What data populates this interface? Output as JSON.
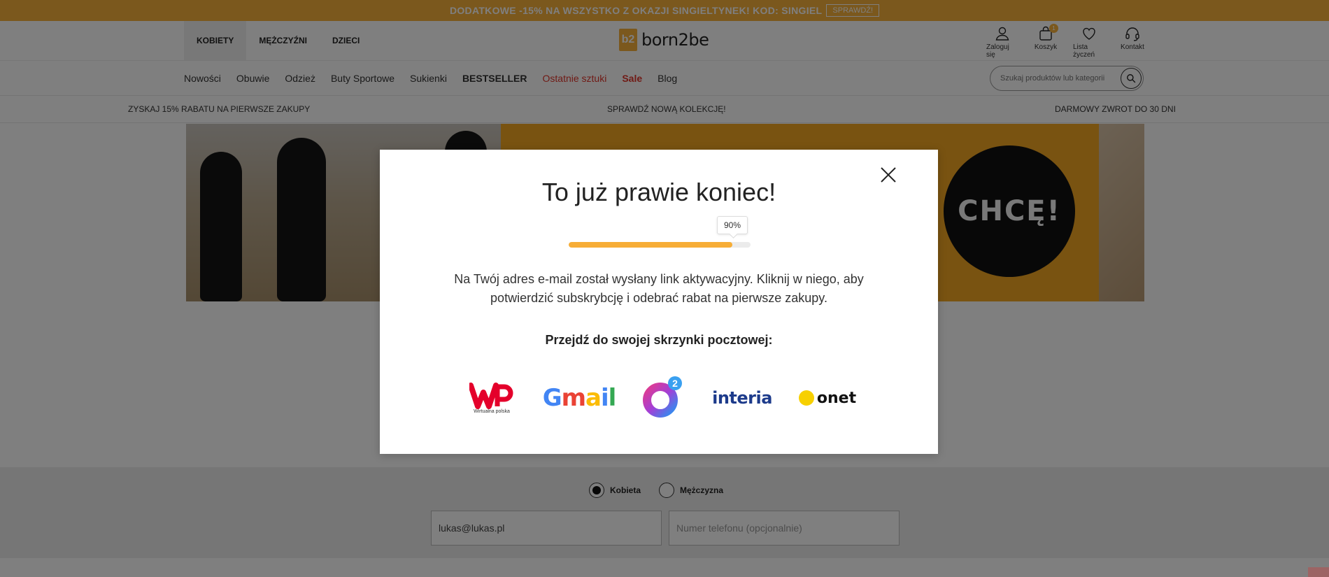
{
  "promo": {
    "text": "DODATKOWE -15% NA WSZYSTKO Z OKAZJI SINGIELTYNEK! KOD: SINGIEL",
    "button": "SPRAWDŹ!"
  },
  "header": {
    "gender_tabs": [
      "KOBIETY",
      "MĘŻCZYŹNI",
      "DZIECI"
    ],
    "logo_mark": "b2",
    "logo_text": "born2be",
    "icons": [
      {
        "label": "Zaloguj się",
        "icon": "user-icon"
      },
      {
        "label": "Koszyk",
        "icon": "bag-icon",
        "badge": "1"
      },
      {
        "label": "Lista życzeń",
        "icon": "heart-icon"
      },
      {
        "label": "Kontakt",
        "icon": "headset-icon"
      }
    ]
  },
  "nav": {
    "items": [
      "Nowości",
      "Obuwie",
      "Odzież",
      "Buty Sportowe",
      "Sukienki",
      "BESTSELLER",
      "Ostatnie sztuki",
      "Sale",
      "Blog"
    ],
    "search_placeholder": "Szukaj produktów lub kategorii"
  },
  "usp": [
    "ZYSKAJ 15% RABATU NA PIERWSZE ZAKUPY",
    "SPRAWDŹ NOWĄ KOLEKCJĘ!",
    "DARMOWY ZWROT DO 30 DNI"
  ],
  "banner": {
    "cta": "CHCĘ!"
  },
  "signup_form": {
    "genders": [
      "Kobieta",
      "Mężczyzna"
    ],
    "selected_gender": "Kobieta",
    "email_value": "lukas@lukas.pl",
    "phone_placeholder": "Numer telefonu (opcjonalnie)"
  },
  "modal": {
    "title": "To już prawie koniec!",
    "progress_label": "90%",
    "progress_value": 0.9,
    "body": "Na Twój adres e-mail został wysłany link aktywacyjny. Kliknij w niego, aby potwierdzić subskrybcję i odebrać rabat na pierwsze zakupy.",
    "cta": "Przejdź do swojej skrzynki pocztowej:",
    "providers": [
      {
        "name": "wp",
        "sub": "Wirtualna polska"
      },
      {
        "name": "gmail",
        "text": "Gmail"
      },
      {
        "name": "o2",
        "badge": "2"
      },
      {
        "name": "interia",
        "text": "interia"
      },
      {
        "name": "onet",
        "text": "onet"
      }
    ]
  },
  "colors": {
    "accent": "#f7b03a",
    "sale_red": "#e0342a",
    "progress": "#f7ad36"
  }
}
